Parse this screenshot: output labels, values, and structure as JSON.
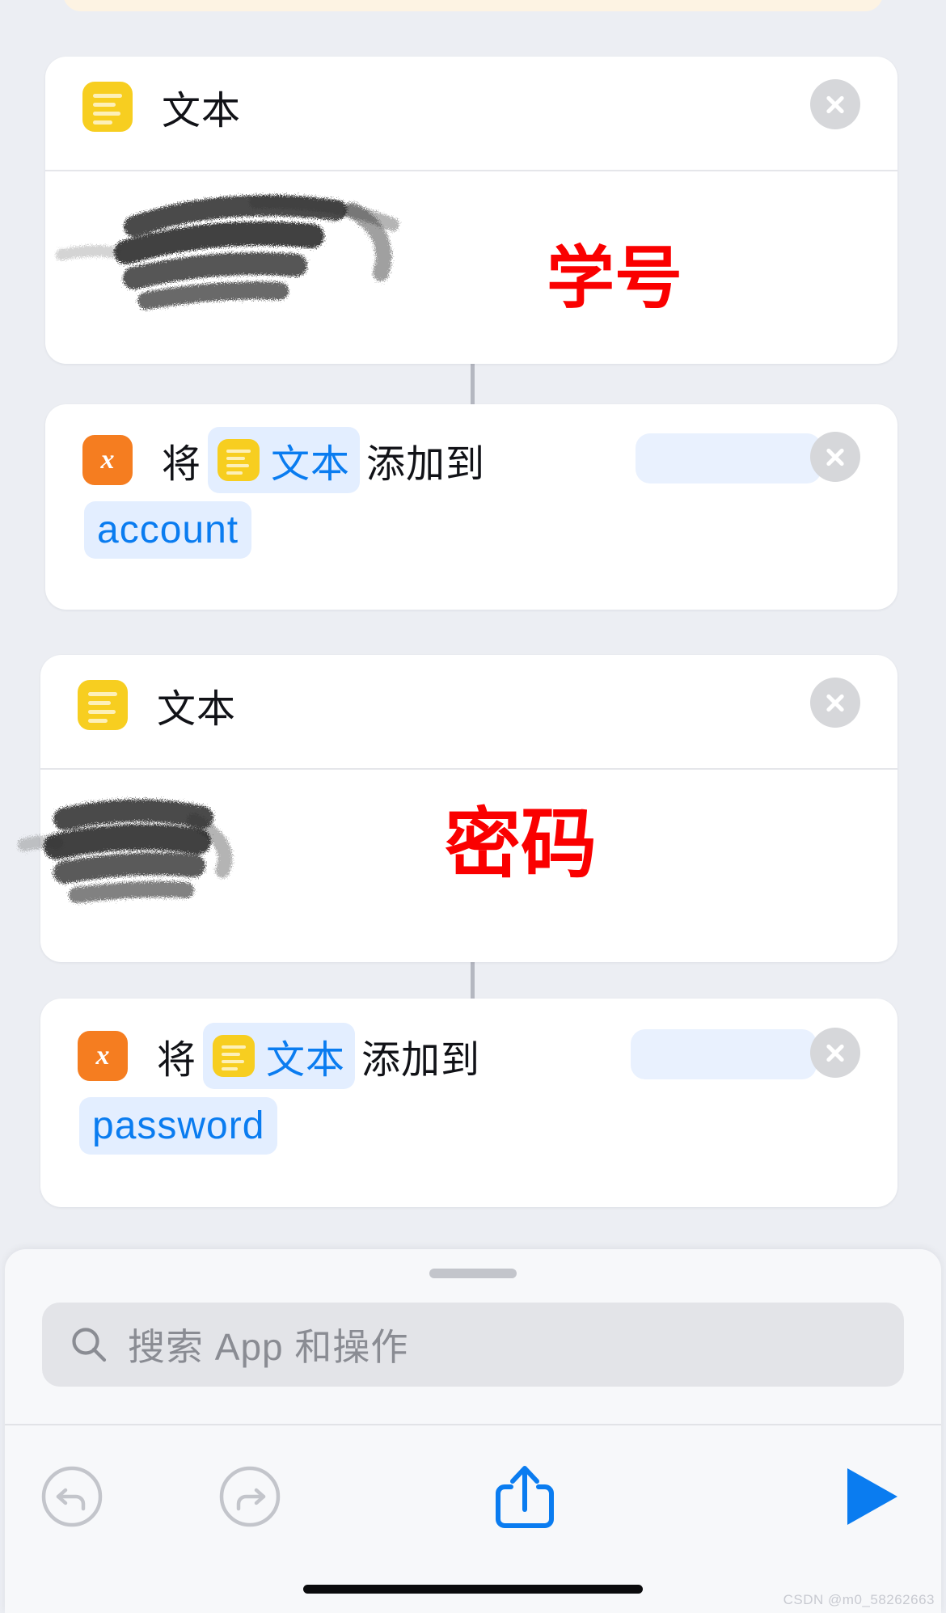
{
  "app": {
    "name": "Shortcuts",
    "background_color": "#eceef3"
  },
  "top_partial_card": {
    "name": "partially-visible-action-card",
    "color": "#fdf3e3"
  },
  "actions": [
    {
      "id": "text-action-1",
      "icon": "text-icon",
      "icon_color": "#f7ce20",
      "title": "文本",
      "close_label": "×",
      "body_redacted": true,
      "annotation": "学号",
      "annotation_color": "#fa0000"
    },
    {
      "id": "add-to-variable-1",
      "icon": "variable-icon",
      "icon_color": "#f57d20",
      "icon_glyph": "x",
      "word_1": "将",
      "token_text": "文本",
      "word_2": "添加到",
      "field_value": "",
      "variable_name": "account",
      "close_label": "×"
    },
    {
      "id": "text-action-2",
      "icon": "text-icon",
      "icon_color": "#f7ce20",
      "title": "文本",
      "close_label": "×",
      "body_redacted": true,
      "annotation": "密码",
      "annotation_color": "#fa0000"
    },
    {
      "id": "add-to-variable-2",
      "icon": "variable-icon",
      "icon_color": "#f57d20",
      "icon_glyph": "x",
      "word_1": "将",
      "token_text": "文本",
      "word_2": "添加到",
      "field_value": "",
      "variable_name": "password",
      "close_label": "×"
    }
  ],
  "sheet": {
    "search": {
      "icon": "search-icon",
      "placeholder": "搜索 App 和操作",
      "value": ""
    },
    "grabber": "drag-handle"
  },
  "toolbar": {
    "undo": {
      "name": "undo-icon",
      "enabled": false,
      "color": "#c3c5cb"
    },
    "redo": {
      "name": "redo-icon",
      "enabled": false,
      "color": "#c3c5cb"
    },
    "share": {
      "name": "share-icon",
      "enabled": true,
      "color": "#0a7cf0"
    },
    "play": {
      "name": "play-icon",
      "enabled": true,
      "color": "#0a7cf0"
    }
  },
  "watermark": "CSDN @m0_58262663",
  "colors": {
    "accent_blue": "#0a7cf0",
    "token_blue_bg": "#e3eeff",
    "field_blue_bg": "#e9f1fe",
    "annotation_red": "#fa0000",
    "icon_yellow": "#f7ce20",
    "icon_orange": "#f57d20",
    "close_gray": "#d6d7da"
  }
}
